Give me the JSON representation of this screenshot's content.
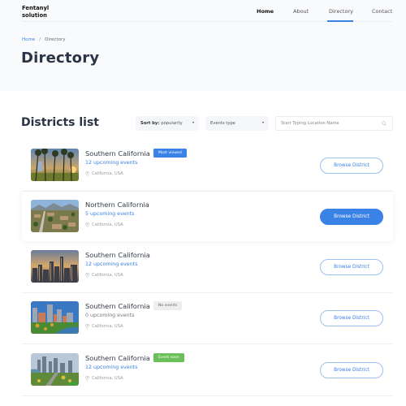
{
  "brand": {
    "line1": "Fentanyl",
    "line2": "solution"
  },
  "nav": {
    "items": [
      {
        "label": "Home",
        "state": "bold"
      },
      {
        "label": "About",
        "state": "normal"
      },
      {
        "label": "Directory",
        "state": "current"
      },
      {
        "label": "Contact",
        "state": "normal"
      }
    ]
  },
  "breadcrumb": {
    "home": "Home",
    "separator": "/",
    "current": "Directory"
  },
  "page_title": "Directory",
  "section": {
    "title": "Districts list",
    "sort": {
      "label": "Sort by:",
      "value": "popularity"
    },
    "events_type": {
      "value": "Events type"
    },
    "search": {
      "placeholder": "Start Typing Location Name"
    }
  },
  "colors": {
    "accent": "#3b82e6",
    "badge_most_viewed": "#3b82e6",
    "badge_no_events": "#eeeeee",
    "badge_event_soon": "#6cc05a"
  },
  "districts": [
    {
      "name": "Southern California",
      "events": "12 upcoming events",
      "location": "California, USA",
      "badge": "Most viewed",
      "button": "Browse District",
      "image": "palm-trees-sunset"
    },
    {
      "name": "Northern California",
      "events": "5 upcoming events",
      "location": "California, USA",
      "badge": "",
      "button": "Browse District",
      "image": "suburb-mountains"
    },
    {
      "name": "Southern California",
      "events": "12 upcoming events",
      "location": "California, USA",
      "badge": "",
      "button": "Browse District",
      "image": "city-skyline-dusk"
    },
    {
      "name": "Southern California",
      "events": "0 upcoming events",
      "location": "California, USA",
      "badge": "No events",
      "button": "Browse District",
      "image": "city-river-skyline"
    },
    {
      "name": "Southern California",
      "events": "12 upcoming events",
      "location": "California, USA",
      "badge": "Event soon",
      "button": "Browse District",
      "image": "city-lake-park"
    }
  ]
}
